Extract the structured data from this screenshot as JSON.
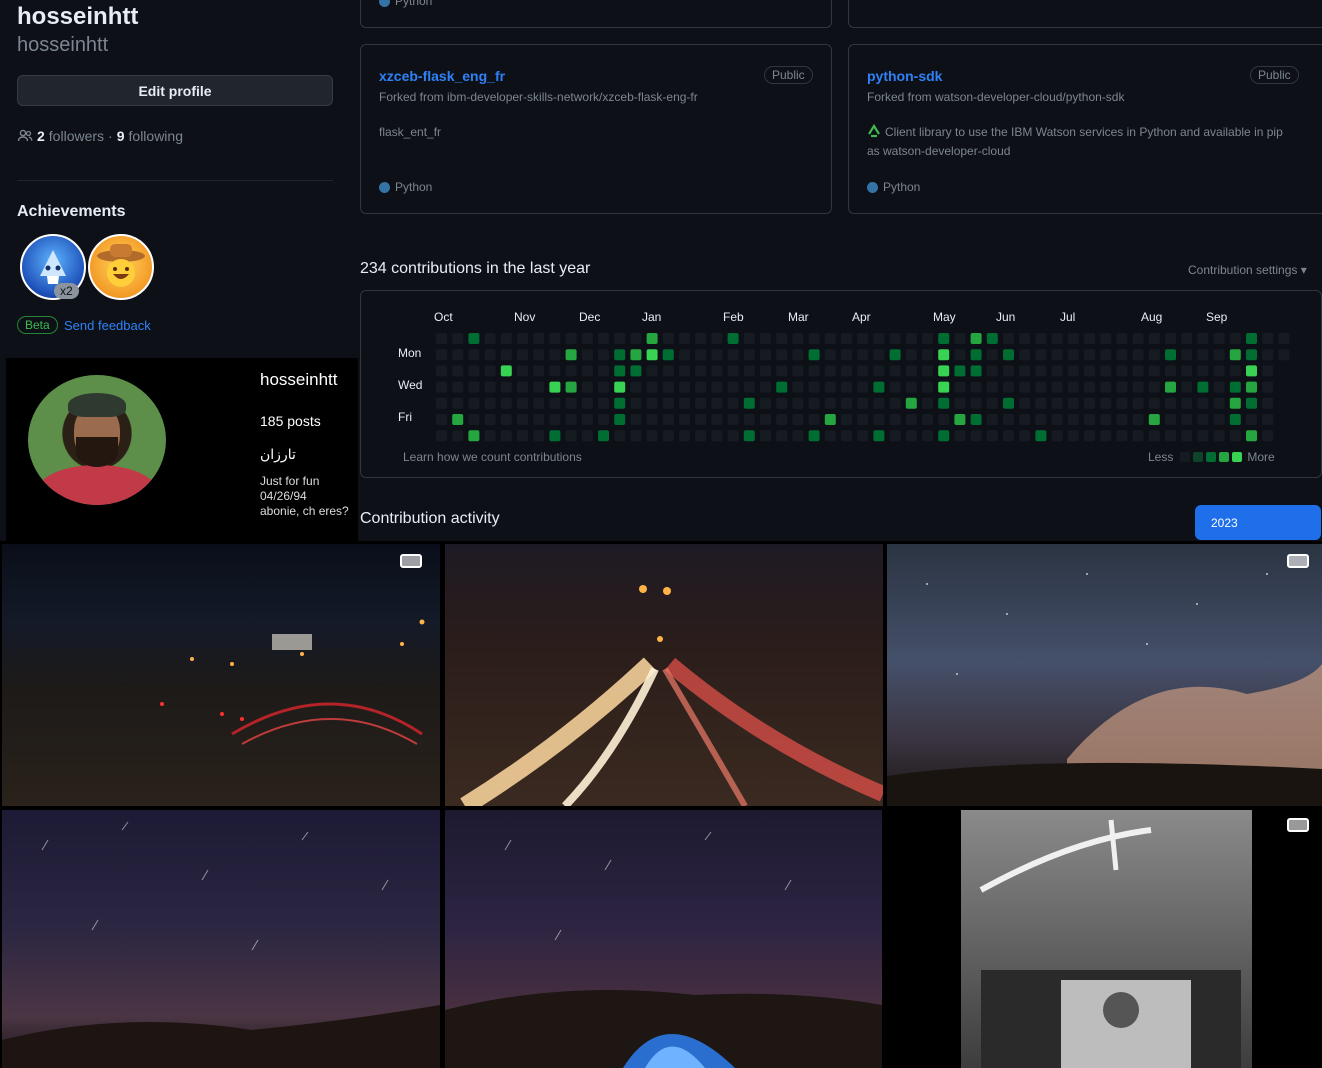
{
  "profile": {
    "username": "hosseinhtt",
    "login": "hosseinhtt",
    "edit_label": "Edit profile",
    "followers_count": "2",
    "followers_label": "followers",
    "following_sep": "·",
    "following_count": "9",
    "following_label": "following"
  },
  "achievements": {
    "title": "Achievements",
    "badges": [
      {
        "name": "shark-badge-icon",
        "count": "x2"
      },
      {
        "name": "cowboy-badge-icon"
      }
    ],
    "beta_label": "Beta",
    "feedback_label": "Send feedback"
  },
  "repos": [
    {
      "name": "xzceb-flask_eng_fr",
      "visibility": "Public",
      "forked": "Forked from ibm-developer-skills-network/xzceb-flask-eng-fr",
      "description": "flask_ent_fr",
      "language": "Python",
      "language_color": "#3572a5"
    },
    {
      "name": "python-sdk",
      "visibility": "Public",
      "forked": "Forked from watson-developer-cloud/python-sdk",
      "description": "Client library to use the IBM Watson services in Python and available in pip as watson-developer-cloud",
      "language": "Python",
      "language_color": "#3572a5"
    }
  ],
  "top_fragment": {
    "language": "Python"
  },
  "contributions": {
    "title": "234 contributions in the last year",
    "settings_label": "Contribution settings",
    "months": [
      "Oct",
      "Nov",
      "Dec",
      "Jan",
      "Feb",
      "Mar",
      "Apr",
      "May",
      "Jun",
      "Jul",
      "Aug",
      "Sep"
    ],
    "days": [
      "Mon",
      "Wed",
      "Fri"
    ],
    "learn_label": "Learn how we count contributions",
    "less_label": "Less",
    "more_label": "More",
    "levels": [
      "#161b22",
      "#0e4429",
      "#006d32",
      "#26a641",
      "#39d353"
    ]
  },
  "activity": {
    "title": "Contribution activity",
    "year": "2023"
  },
  "instagram": {
    "username": "hosseinhtt",
    "posts": "185 posts",
    "name": "تارزان",
    "bio_line1": "Just for fun",
    "bio_line2": "04/26/94",
    "bio_line3": "abonie, ch eres?"
  },
  "photos": [
    {
      "name": "photo-city-night",
      "multi": true
    },
    {
      "name": "photo-light-trails",
      "multi": false
    },
    {
      "name": "photo-starry-cloud",
      "multi": true
    },
    {
      "name": "photo-star-trails",
      "multi": false
    },
    {
      "name": "photo-tent-night",
      "multi": false
    },
    {
      "name": "photo-azadi-building",
      "multi": true
    }
  ]
}
